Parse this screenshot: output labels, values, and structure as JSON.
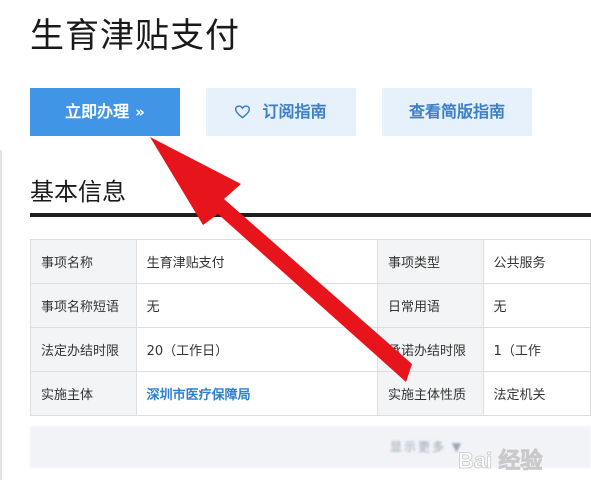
{
  "page": {
    "title": "生育津贴支付"
  },
  "actions": {
    "apply_label": "立即办理",
    "apply_chevron": "»",
    "subscribe_label": "订阅指南",
    "simple_label": "查看简版指南"
  },
  "section": {
    "title": "基本信息"
  },
  "info": {
    "rows": [
      {
        "label1": "事项名称",
        "value1": "生育津贴支付",
        "label2": "事项类型",
        "value2": "公共服务"
      },
      {
        "label1": "事项名称短语",
        "value1": "无",
        "label2": "日常用语",
        "value2": "无"
      },
      {
        "label1": "法定办结时限",
        "value1": "20（工作日）",
        "label2": "承诺办结时限",
        "value2": "1（工作"
      },
      {
        "label1": "实施主体",
        "value1": "深圳市医疗保障局",
        "label2": "实施主体性质",
        "value2": "法定机关"
      }
    ]
  },
  "footer": {
    "blurred_text": "显示更多 ▼",
    "watermark_text": "Bai 经验"
  },
  "icons": {
    "heart": "heart-icon",
    "chevron": "double-chevron-right-icon"
  },
  "colors": {
    "primary": "#4095e6",
    "secondary_bg": "#e6f1fb",
    "secondary_text": "#3d7fc6",
    "link": "#2f7fd1",
    "annotation_arrow": "#e8141b"
  }
}
